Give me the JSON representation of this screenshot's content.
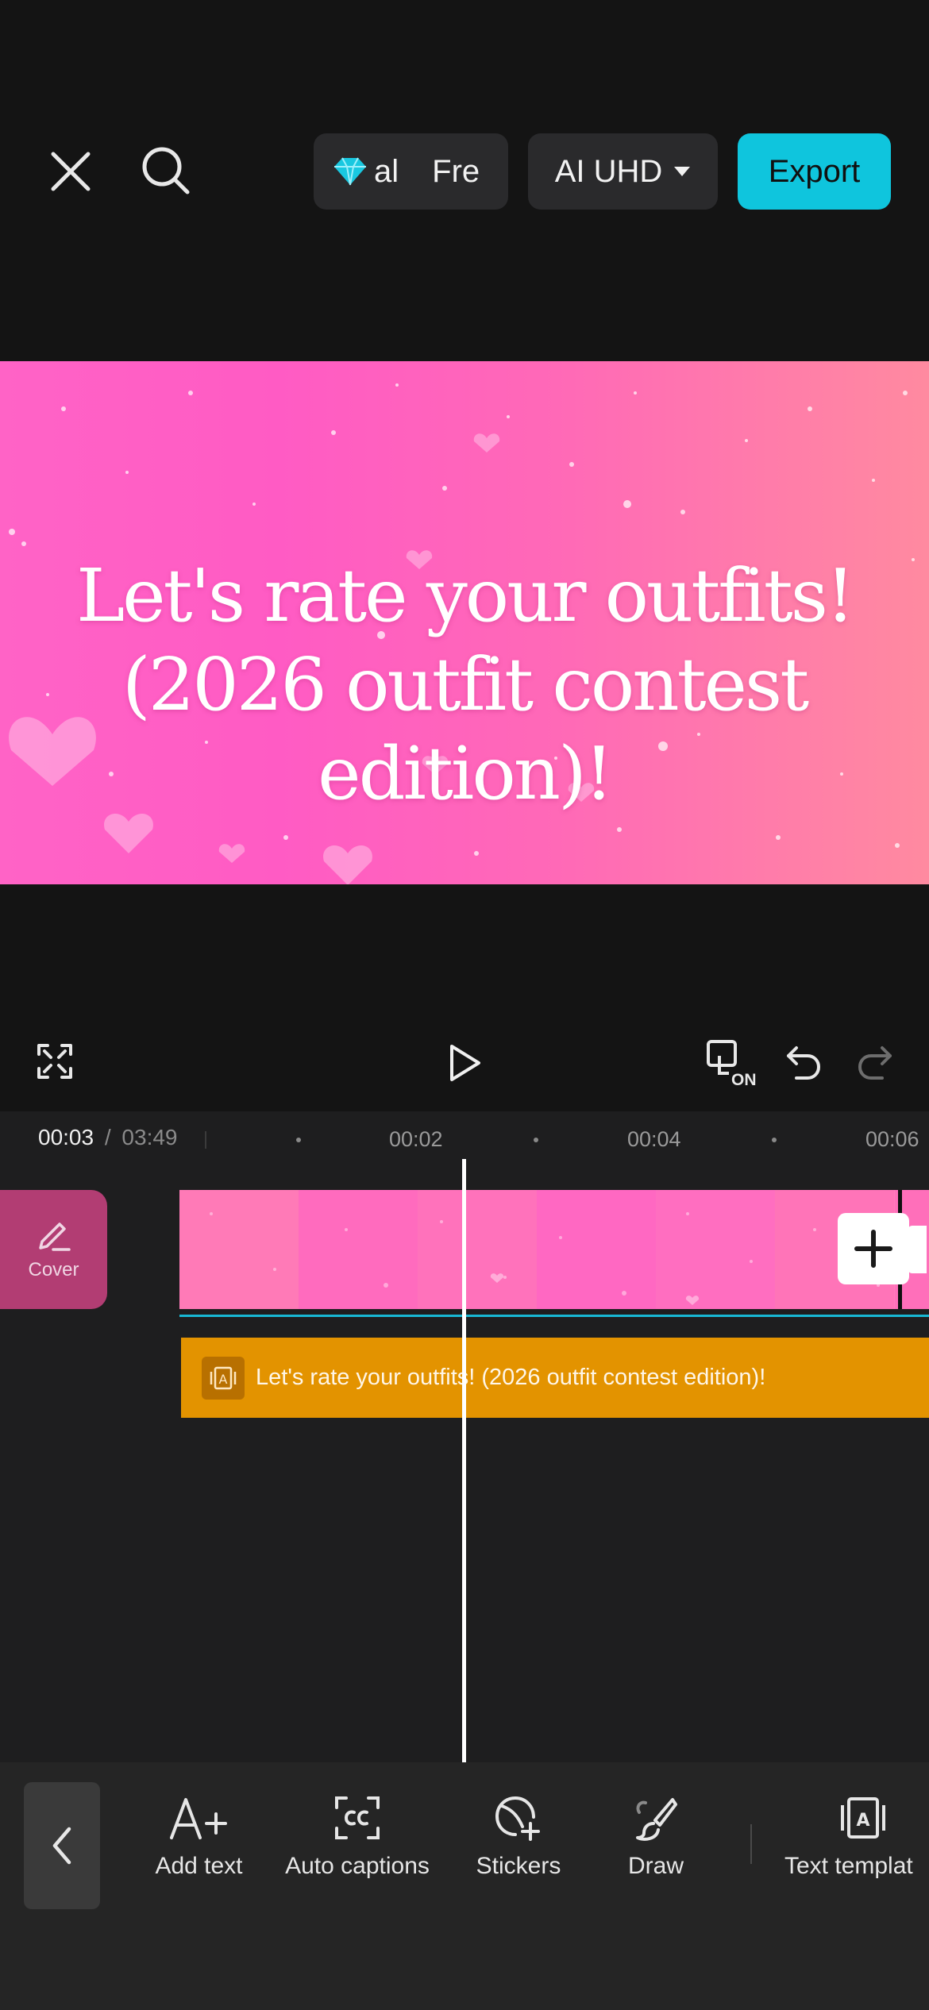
{
  "topbar": {
    "plan_pill_text_left": "al",
    "plan_pill_text_right": "Fre",
    "quality_label": "AI UHD",
    "export_label": "Export"
  },
  "preview": {
    "title_line1": "Let's rate your outfits!",
    "title_line2": "(2026 outfit contest edition)!"
  },
  "controls": {
    "on_badge": "ON"
  },
  "timeline": {
    "current_time": "00:03",
    "separator": "/",
    "total_time": "03:49",
    "ruler_marks": [
      "00:02",
      "00:04",
      "00:06"
    ],
    "cover_label": "Cover",
    "text_clip_label": "Let's rate your outfits! (2026 outfit contest edition)!",
    "text_clip_icon": "A"
  },
  "toolbar": {
    "items": [
      {
        "label": "Add text",
        "icon": "add-text-icon"
      },
      {
        "label": "Auto captions",
        "icon": "captions-icon"
      },
      {
        "label": "Stickers",
        "icon": "sticker-icon"
      },
      {
        "label": "Draw",
        "icon": "brush-icon"
      },
      {
        "label": "Text templat",
        "icon": "text-template-icon"
      }
    ],
    "text_template_glyph": "A"
  },
  "colors": {
    "accent": "#0fc5dd",
    "text_track": "#e39300",
    "cover": "#b23d73"
  }
}
